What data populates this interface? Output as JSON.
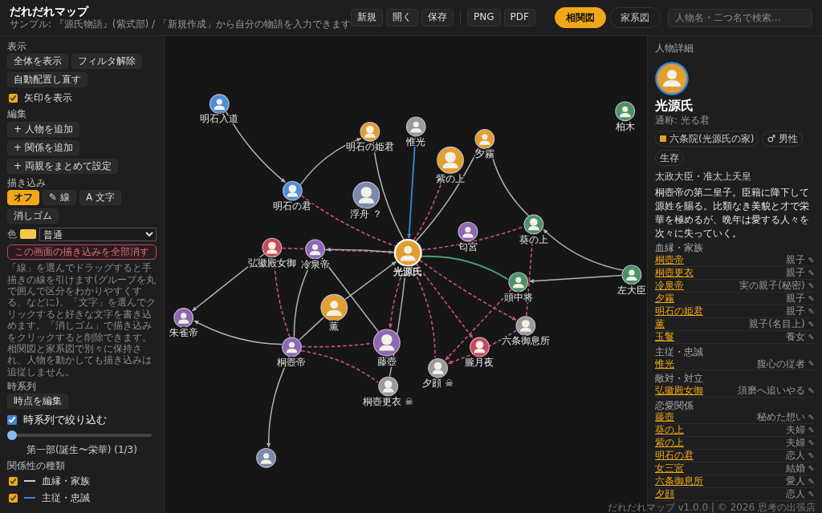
{
  "app": {
    "title": "だれだれマップ",
    "subtitle": "サンプル: 『源氏物語』(紫式部) / 「新規作成」から自分の物語を入力できます"
  },
  "toolbar": {
    "file_buttons": [
      "新規",
      "開く",
      "保存"
    ],
    "export_buttons": [
      "PNG",
      "PDF"
    ]
  },
  "view_tabs": [
    {
      "label": "相関図",
      "selected": true
    },
    {
      "label": "家系図",
      "selected": false
    }
  ],
  "search": {
    "placeholder": "人物名・二つ名で検索..."
  },
  "sidebar": {
    "display": {
      "heading": "表示",
      "buttons": [
        "全体を表示",
        "フィルタ解除",
        "自動配置し直す"
      ],
      "show_arrows": {
        "label": "矢印を表示",
        "checked": true
      }
    },
    "edit": {
      "heading": "編集",
      "buttons": [
        "+ 人物を追加",
        "+ 関係を追加",
        "+ 両親をまとめて設定"
      ]
    },
    "drawing": {
      "heading": "描き込み",
      "modes": [
        {
          "label": "オフ",
          "selected": true
        },
        {
          "label": "✎ 線",
          "selected": false
        },
        {
          "label": "A 文字",
          "selected": false
        },
        {
          "label": "消しゴム",
          "selected": false
        }
      ],
      "color_label": "色",
      "size": "普通",
      "clear_button": "この画面の描き込みを全部消す",
      "help": "「線」を選んでドラッグすると手描きの線を引けます(グループを丸で囲んで区分をわかりやすくする、などに)。「文字」を選んでクリックすると好きな文字を書き込めます。「消しゴム」で描き込みをクリックすると削除できます。相関図と家系図で別々に保持され、人物を動かしても描き込みは追従しません。"
    },
    "timeline": {
      "heading": "時系列",
      "edit_button": "時点を編集",
      "filter": {
        "label": "時系列で絞り込む",
        "checked": true
      },
      "slider": {
        "level": 0
      },
      "period": "第一部(誕生〜栄華) (1/3)"
    },
    "relation_types": {
      "heading": "関係性の種類",
      "items": [
        {
          "label": "血縁・家族",
          "checked": true,
          "color": "#cfcfcf"
        },
        {
          "label": "主従・忠誠",
          "checked": true,
          "color": "#3d85d8"
        }
      ]
    }
  },
  "graph": {
    "nodes": [
      {
        "name": "明石入道",
        "color": "#4a90d9",
        "kind": "male",
        "selected": false
      },
      {
        "name": "柏木",
        "color": "#4a9468",
        "kind": "male",
        "selected": false
      },
      {
        "name": "明石の姫君",
        "color": "#e0a030",
        "kind": "female",
        "selected": false
      },
      {
        "name": "惟光",
        "color": "#9a9a9a",
        "kind": "male",
        "selected": false
      },
      {
        "name": "夕霧",
        "color": "#e0a030",
        "kind": "male",
        "selected": false
      },
      {
        "name": "紫の上",
        "color": "#e0a030",
        "kind": "female",
        "selected": false
      },
      {
        "name": "明石の君",
        "color": "#4a90d9",
        "kind": "female",
        "selected": false
      },
      {
        "name": "浮舟 ？",
        "color": "#7a8aae",
        "kind": "female",
        "selected": false
      },
      {
        "name": "匂宮",
        "color": "#8e68b5",
        "kind": "male",
        "selected": false
      },
      {
        "name": "葵の上",
        "color": "#4a9468",
        "kind": "female",
        "selected": false
      },
      {
        "name": "弘徽殿女御",
        "color": "#c9485b",
        "kind": "female",
        "selected": false
      },
      {
        "name": "冷泉帝",
        "color": "#8e68b5",
        "kind": "male",
        "selected": false
      },
      {
        "name": "光源氏",
        "color": "#e0a030",
        "kind": "male",
        "selected": true
      },
      {
        "name": "頭中将",
        "color": "#4a9468",
        "kind": "male",
        "selected": false
      },
      {
        "name": "左大臣",
        "color": "#4a9468",
        "kind": "male",
        "selected": false
      },
      {
        "name": "朱雀帝",
        "color": "#8e68b5",
        "kind": "male",
        "selected": false
      },
      {
        "name": "薫",
        "color": "#e0a030",
        "kind": "male",
        "selected": false
      },
      {
        "name": "六条御息所",
        "color": "#9a9a9a",
        "kind": "female",
        "selected": false
      },
      {
        "name": "桐壺帝",
        "color": "#8e68b5",
        "kind": "male",
        "selected": false
      },
      {
        "name": "藤壺",
        "color": "#8e68b5",
        "kind": "female",
        "selected": false
      },
      {
        "name": "朧月夜",
        "color": "#c9485b",
        "kind": "female",
        "selected": false
      },
      {
        "name": "夕顔 ☠",
        "color": "#9a9a9a",
        "kind": "female",
        "selected": false
      },
      {
        "name": "桐壺更衣 ☠",
        "color": "#9a9a9a",
        "kind": "female",
        "selected": false
      },
      {
        "color": "#7a8aae",
        "kind": "male",
        "selected": false
      }
    ]
  },
  "detail": {
    "heading": "人物詳細",
    "name": "光源氏",
    "alias": "通称: 光る君",
    "tags": [
      {
        "kind": "house",
        "label": "六条院(光源氏の家)"
      },
      {
        "kind": "plain",
        "label": "♂ 男性"
      },
      {
        "kind": "plain",
        "label": "生存"
      }
    ],
    "position": "太政大臣・准太上天皇",
    "description": "桐壺帝の第二皇子。臣籍に降下して源姓を賜る。比類なき美貌と才で栄華を極めるが、晩年は愛する人々を次々に失っていく。",
    "relation_groups": [
      {
        "heading": "血縁・家族",
        "rows": [
          {
            "name": "桐壺帝",
            "relation": "親子",
            "edit": "✎"
          },
          {
            "name": "桐壺更衣",
            "relation": "親子",
            "edit": "✎"
          },
          {
            "name": "冷泉帝",
            "relation": "実の親子(秘密)",
            "edit": "✎"
          },
          {
            "name": "夕霧",
            "relation": "親子",
            "edit": "✎"
          },
          {
            "name": "明石の姫君",
            "relation": "親子",
            "edit": "✎"
          },
          {
            "name": "薫",
            "relation": "親子(名目上)",
            "edit": "✎"
          },
          {
            "name": "玉鬘",
            "relation": "養女",
            "edit": "✎"
          }
        ]
      },
      {
        "heading": "主従・忠誠",
        "rows": [
          {
            "name": "惟光",
            "relation": "腹心の従者",
            "edit": "✎"
          }
        ]
      },
      {
        "heading": "敵対・対立",
        "rows": [
          {
            "name": "弘徽殿女御",
            "relation": "須磨へ追いやる",
            "edit": "✎"
          }
        ]
      },
      {
        "heading": "恋愛関係",
        "rows": [
          {
            "name": "藤壺",
            "relation": "秘めた想い",
            "edit": "✎"
          },
          {
            "name": "葵の上",
            "relation": "夫婦",
            "edit": "✎"
          },
          {
            "name": "紫の上",
            "relation": "夫婦",
            "edit": "✎"
          },
          {
            "name": "明石の君",
            "relation": "恋人",
            "edit": "✎"
          },
          {
            "name": "女三宮",
            "relation": "結婚",
            "edit": "✎"
          },
          {
            "name": "六条御息所",
            "relation": "愛人",
            "edit": "✎"
          },
          {
            "name": "夕顔",
            "relation": "恋人",
            "edit": "✎"
          }
        ]
      }
    ]
  },
  "footer": "だれだれマップ v1.0.0 | © 2026 思考の出張店"
}
